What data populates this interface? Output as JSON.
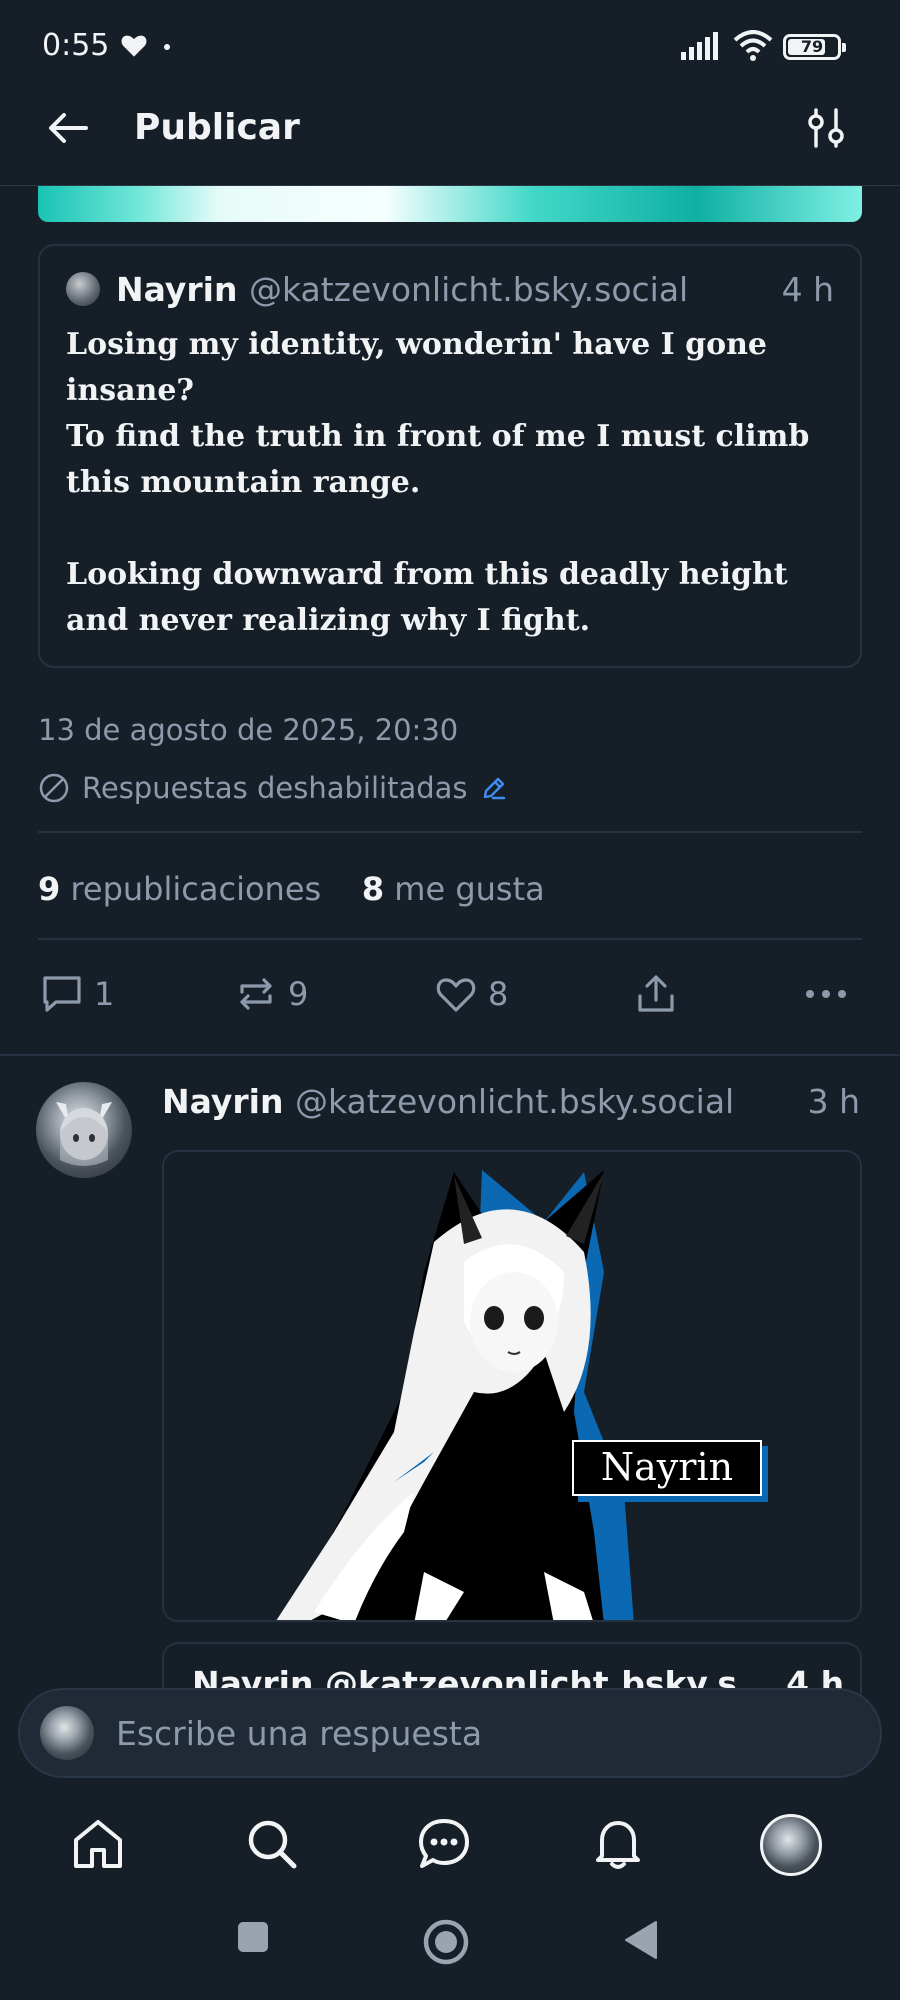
{
  "status_bar": {
    "time": "0:55",
    "battery": "79",
    "battery_level": 0.79
  },
  "header": {
    "title": "Publicar"
  },
  "quoted_post": {
    "author_name": "Nayrin",
    "author_handle": "@katzevonlicht.bsky.social",
    "time": "4 h",
    "body": "Losing my identity, wonderin' have I gone insane?\nTo find the truth in front of me I must climb this mountain range.\n\nLooking downward from this deadly height and never realizing why I fight."
  },
  "post_meta": {
    "date": "13 de agosto de 2025, 20:30",
    "replies_status": "Respuestas deshabilitadas"
  },
  "counts": {
    "reposts_number": "9",
    "reposts_label": "republicaciones",
    "likes_number": "8",
    "likes_label": "me gusta"
  },
  "actions": {
    "reply_count": "1",
    "repost_count": "9",
    "like_count": "8"
  },
  "second_post": {
    "author_name": "Nayrin",
    "author_handle": "@katzevonlicht.bsky.social",
    "time": "3 h",
    "image_tag": "Nayrin",
    "next_quote_peek": "Nayrin @katzevonlicht.bsky.s... 4 h"
  },
  "reply_bar": {
    "placeholder": "Escribe una respuesta"
  },
  "icons": {
    "back": "arrow-left-icon",
    "filter": "sliders-icon",
    "reply": "comment-icon",
    "repost": "repost-icon",
    "like": "heart-icon",
    "share": "share-icon",
    "more": "more-icon",
    "nav": [
      "home-icon",
      "search-icon",
      "chat-icon",
      "bell-icon",
      "profile-avatar"
    ]
  },
  "colors": {
    "background": "#161e27",
    "accent": "#3f8cf3",
    "muted": "#8d9aab",
    "border": "#263240"
  }
}
